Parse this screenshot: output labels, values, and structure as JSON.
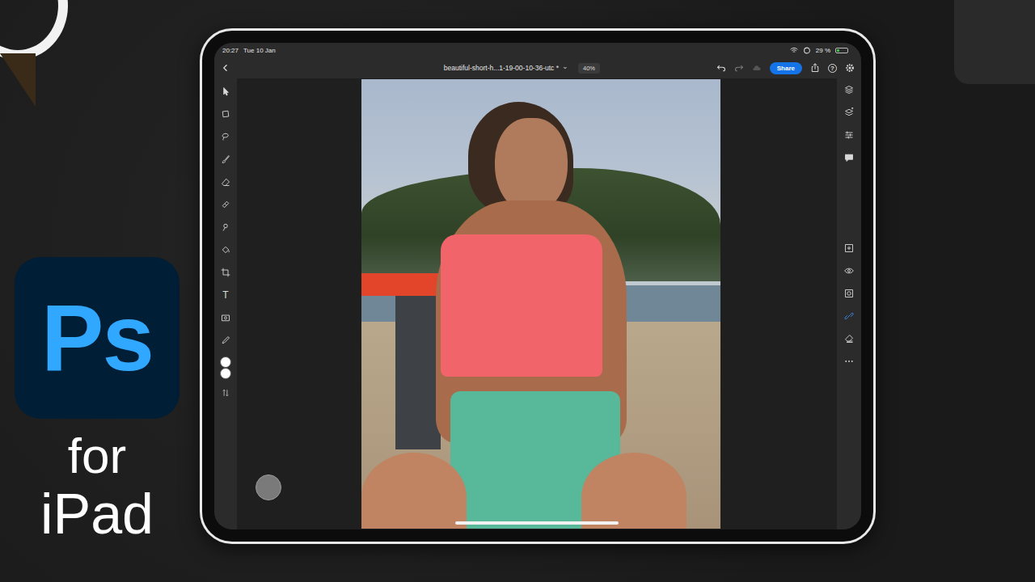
{
  "logo": {
    "text": "Ps"
  },
  "caption": [
    "for",
    "iPad"
  ],
  "status_bar": {
    "time": "20:27",
    "date": "Tue 10 Jan",
    "battery": "29 %",
    "battery_level": 0.29,
    "charging": true
  },
  "toolbar": {
    "document_title": "beautiful-short-h...1-19-00-10-36-utc *",
    "title_menu": "⌄",
    "zoom": "40%",
    "share": "Share",
    "help": "?",
    "undo_enabled": true,
    "redo_enabled": false
  },
  "left_tools": [
    {
      "kind": "icon",
      "selected": false
    },
    {
      "kind": "icon",
      "selected": false
    },
    {
      "kind": "icon",
      "selected": false
    },
    {
      "kind": "icon",
      "selected": false
    },
    {
      "kind": "icon",
      "selected": false
    },
    {
      "kind": "icon",
      "selected": false
    },
    {
      "kind": "icon",
      "selected": false
    },
    {
      "kind": "icon",
      "selected": false
    },
    {
      "kind": "icon",
      "selected": false
    },
    {
      "kind": "glyph",
      "label": "T",
      "selected": false
    },
    {
      "kind": "icon",
      "selected": false
    },
    {
      "kind": "icon",
      "selected": false
    }
  ],
  "color_swatches": [
    {
      "color": "#ffffff"
    },
    {
      "color": "#ffffff"
    }
  ],
  "right_panels": [
    {
      "selected": false
    },
    {
      "selected": false
    },
    {
      "selected": false
    },
    {
      "selected": false
    }
  ],
  "layer_actions": [
    {
      "selected": false
    },
    {
      "selected": false
    },
    {
      "selected": false
    },
    {
      "selected": true
    },
    {
      "selected": false
    },
    {
      "selected": false
    }
  ]
}
